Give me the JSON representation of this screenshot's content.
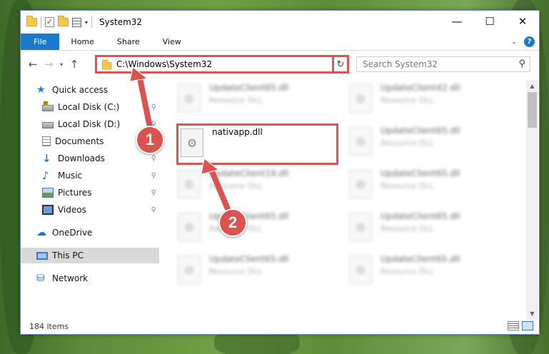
{
  "window": {
    "title": "System32",
    "controls": {
      "minimize": "—",
      "maximize": "☐",
      "close": "✕"
    }
  },
  "ribbon": {
    "tabs": [
      "File",
      "Home",
      "Share",
      "View"
    ],
    "expand_icon": "chevron-down-icon",
    "help_icon": "?"
  },
  "nav": {
    "back": "←",
    "forward": "→",
    "recent": "▾",
    "up": "↑",
    "address": "C:\\Windows\\System32",
    "refresh": "↻",
    "search_placeholder": "Search System32",
    "search_icon": "⚲"
  },
  "sidebar": {
    "items": [
      {
        "label": "Quick access",
        "icon": "star-icon",
        "pinned": false
      },
      {
        "label": "Local Disk (C:)",
        "icon": "drive-icon",
        "pinned": true
      },
      {
        "label": "Local Disk (D:)",
        "icon": "drive-icon",
        "pinned": true
      },
      {
        "label": "Documents",
        "icon": "document-icon",
        "pinned": true
      },
      {
        "label": "Downloads",
        "icon": "download-icon",
        "pinned": true
      },
      {
        "label": "Music",
        "icon": "music-icon",
        "pinned": true
      },
      {
        "label": "Pictures",
        "icon": "picture-icon",
        "pinned": true
      },
      {
        "label": "Videos",
        "icon": "video-icon",
        "pinned": true
      },
      {
        "label": "OneDrive",
        "icon": "cloud-icon",
        "pinned": false
      },
      {
        "label": "This PC",
        "icon": "computer-icon",
        "pinned": false,
        "selected": true
      },
      {
        "label": "Network",
        "icon": "network-icon",
        "pinned": false
      }
    ],
    "pin_glyph": "📌"
  },
  "files": [
    {
      "name": "UpdateClient65.dll",
      "type": "Resource DLL",
      "blurred": true
    },
    {
      "name": "UpdateClient42.dll",
      "type": "Resource DLL",
      "blurred": true
    },
    {
      "name": "nativapp.dll",
      "type": "",
      "blurred": false
    },
    {
      "name": "UpdateClient65.dll",
      "type": "Resource DLL",
      "blurred": true
    },
    {
      "name": "UpdateClient19.dll",
      "type": "Resource DLL",
      "blurred": true
    },
    {
      "name": "UpdateClient65.dll",
      "type": "Resource DLL",
      "blurred": true
    },
    {
      "name": "UpdateClient65.dll",
      "type": "Resource DLL",
      "blurred": true
    },
    {
      "name": "UpdateClient65.dll",
      "type": "Resource DLL",
      "blurred": true
    },
    {
      "name": "UpdateClient65.dll",
      "type": "Resource DLL",
      "blurred": true
    },
    {
      "name": "UpdateClient65.dll",
      "type": "Resource DLL",
      "blurred": true
    }
  ],
  "status": {
    "item_count": "184 items"
  },
  "annotations": {
    "step1": "1",
    "step2": "2",
    "color": "#d9534f"
  }
}
